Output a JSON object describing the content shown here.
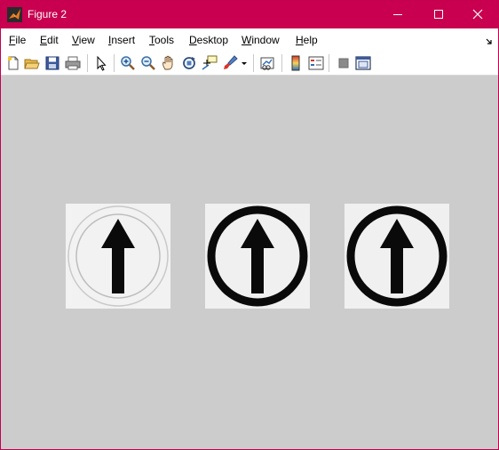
{
  "window": {
    "title": "Figure 2",
    "accent_color": "#c8004f"
  },
  "menu": {
    "items": [
      {
        "mnemonic": "F",
        "rest": "ile"
      },
      {
        "mnemonic": "E",
        "rest": "dit"
      },
      {
        "mnemonic": "V",
        "rest": "iew"
      },
      {
        "mnemonic": "I",
        "rest": "nsert"
      },
      {
        "mnemonic": "T",
        "rest": "ools"
      },
      {
        "mnemonic": "D",
        "rest": "esktop"
      },
      {
        "mnemonic": "W",
        "rest": "indow"
      },
      {
        "mnemonic": "H",
        "rest": "elp"
      }
    ]
  },
  "toolbar": {
    "icons": [
      "new-figure-icon",
      "open-file-icon",
      "save-icon",
      "print-icon",
      "edit-plot-icon",
      "zoom-in-icon",
      "zoom-out-icon",
      "pan-icon",
      "rotate-3d-icon",
      "data-cursor-icon",
      "brush-icon",
      "link-plot-icon",
      "colorbar-icon",
      "legend-icon",
      "hide-plot-tools-icon",
      "show-plot-tools-icon"
    ]
  },
  "figure": {
    "background": "#cccccc",
    "images": [
      {
        "name": "faint-ring-arrow-image",
        "description_style": "light outline ring"
      },
      {
        "name": "bold-ring-arrow-image-1",
        "description_style": "thick black ring"
      },
      {
        "name": "bold-ring-arrow-image-2",
        "description_style": "thick black ring"
      }
    ]
  }
}
